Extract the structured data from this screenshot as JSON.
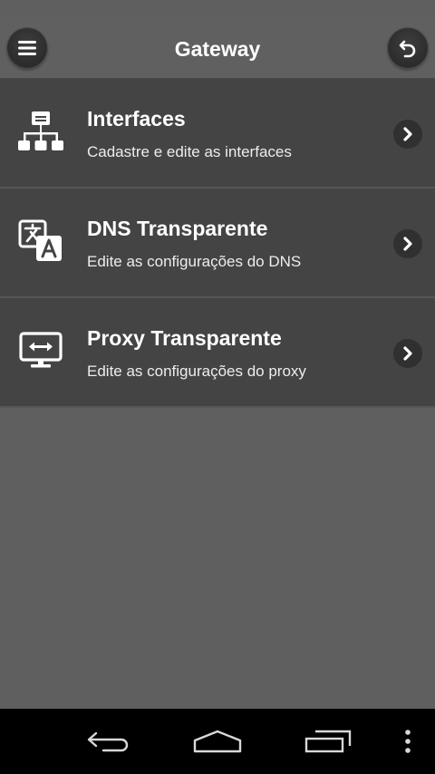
{
  "header": {
    "title": "Gateway",
    "menu_icon": "hamburger-menu-icon",
    "back_icon": "undo-back-icon"
  },
  "items": [
    {
      "title": "Interfaces",
      "subtitle": "Cadastre e edite as interfaces",
      "icon": "network-hierarchy-icon"
    },
    {
      "title": "DNS Transparente",
      "subtitle": "Edite as configurações do DNS",
      "icon": "translate-icon"
    },
    {
      "title": "Proxy Transparente",
      "subtitle": "Edite as configurações do proxy",
      "icon": "monitor-arrows-icon"
    }
  ],
  "navigation_bar": {
    "back_icon": "nav-back-icon",
    "home_icon": "nav-home-icon",
    "recents_icon": "nav-recents-icon",
    "overflow_icon": "nav-overflow-menu-icon"
  },
  "colors": {
    "background": "#5f5f5f",
    "list_item_bg": "#444444",
    "nav_bar_bg": "#000000",
    "text": "#ffffff"
  }
}
